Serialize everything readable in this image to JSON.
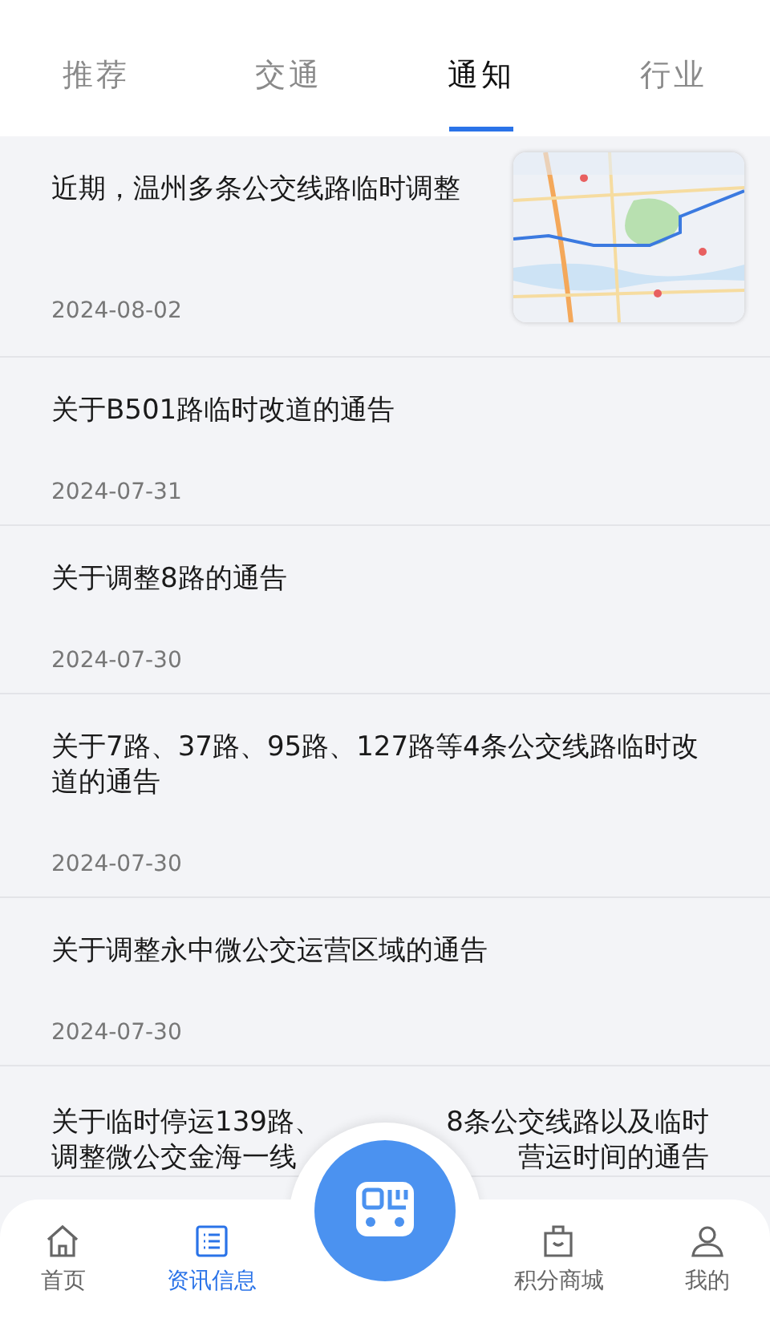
{
  "tabs": [
    {
      "label": "推荐",
      "selected": false
    },
    {
      "label": "交通",
      "selected": false
    },
    {
      "label": "通知",
      "selected": true
    },
    {
      "label": "行业",
      "selected": false
    }
  ],
  "news": [
    {
      "kind": "picture",
      "title": "近期，温州多条公交线路临时调整",
      "date": "2024-08-02"
    },
    {
      "kind": "text",
      "title": "关于B501路临时改道的通告",
      "date": "2024-07-31"
    },
    {
      "kind": "text",
      "title": "关于调整8路的通告",
      "date": "2024-07-30"
    },
    {
      "kind": "text",
      "title": "关于7路、37路、95路、127路等4条公交线路临时改道的通告",
      "date": "2024-07-30"
    },
    {
      "kind": "text",
      "title": "关于调整永中微公交运营区域的通告",
      "date": "2024-07-30"
    },
    {
      "kind": "covered",
      "lines": [
        [
          "关于临时停运139路、",
          "8条公交线路以及临时"
        ],
        [
          "调整微公交金海一线",
          "营运时间的通告"
        ]
      ]
    }
  ],
  "nav": [
    {
      "label": "首页",
      "kind": "home",
      "selected": false
    },
    {
      "label": "资讯信息",
      "kind": "list",
      "selected": true
    },
    {
      "label": "积分商城",
      "kind": "bag",
      "selected": false
    },
    {
      "label": "我的",
      "kind": "user",
      "selected": false
    }
  ]
}
